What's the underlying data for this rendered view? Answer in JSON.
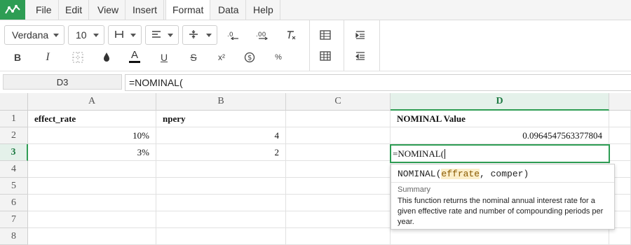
{
  "menubar": {
    "items": [
      "File",
      "Edit",
      "View",
      "Insert",
      "Format",
      "Data",
      "Help"
    ],
    "active": "Format"
  },
  "toolbar": {
    "font_family": "Verdana",
    "font_size": "10",
    "icons": [
      "borders-icon",
      "align-left-icon",
      "vertical-align-icon",
      "decrease-decimal-icon",
      "increase-decimal-icon",
      "clear-format-icon",
      "merge-cells-icon",
      "table-icon",
      "indent-icon",
      "outdent-icon",
      "bold-icon",
      "italic-icon",
      "grid-lines-icon",
      "fill-color-icon",
      "text-color-icon",
      "underline-icon",
      "strikethrough-icon",
      "superscript-icon",
      "currency-icon",
      "percent-icon"
    ],
    "bold": "B",
    "italic": "I",
    "text_color": "A",
    "underline": "U",
    "strike": "S",
    "superscript": "x²",
    "percent": "%",
    "accent_color": "#2e9d54"
  },
  "formula_bar": {
    "cell_ref": "D3",
    "formula": "=NOMINAL("
  },
  "sheet": {
    "columns": [
      "A",
      "B",
      "C",
      "D"
    ],
    "rows": [
      "1",
      "2",
      "3",
      "4",
      "5",
      "6",
      "7",
      "8"
    ],
    "selected_column": "D",
    "selected_row": "3",
    "cells": {
      "A1": "effect_rate",
      "B1": "npery",
      "D1": "NOMINAL Value",
      "A2": "10%",
      "B2": "4",
      "D2": "0.0964547563377804",
      "A3": "3%",
      "B3": "2"
    },
    "editing_value": "=NOMINAL("
  },
  "autocomplete": {
    "fn": "NOMINAL(",
    "arg1": "effrate",
    "rest": ", comper)",
    "summary_label": "Summary",
    "description": "This function returns the nominal annual interest rate for a given effective rate and number of compounding periods per year."
  }
}
